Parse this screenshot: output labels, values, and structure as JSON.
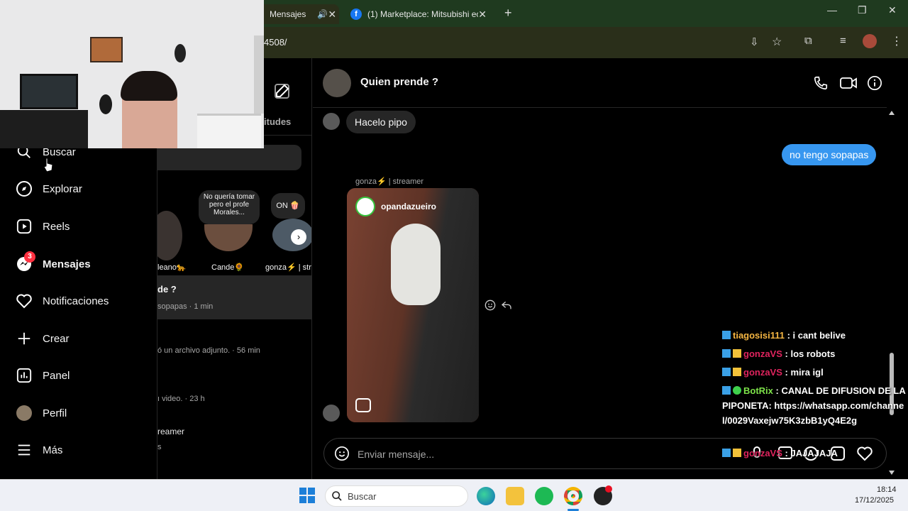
{
  "browser": {
    "tabs": [
      {
        "label": "Mensajes",
        "active": true
      },
      {
        "label": "(1) Marketplace: Mitsubishi ecli",
        "active": false
      }
    ],
    "url_fragment": "4508/"
  },
  "nav": {
    "items": [
      {
        "label": "Buscar",
        "icon": "search-icon"
      },
      {
        "label": "Explorar",
        "icon": "compass-icon"
      },
      {
        "label": "Reels",
        "icon": "reels-icon"
      },
      {
        "label": "Mensajes",
        "icon": "messenger-icon",
        "badge": "3"
      },
      {
        "label": "Notificaciones",
        "icon": "heart-icon"
      },
      {
        "label": "Crear",
        "icon": "plus-icon"
      },
      {
        "label": "Panel",
        "icon": "chart-icon"
      },
      {
        "label": "Perfil",
        "icon": "avatar"
      },
      {
        "label": "Más",
        "icon": "menu-icon"
      }
    ]
  },
  "inbox": {
    "requests_label": "itudes",
    "notes": [
      {
        "note": "",
        "name": "leano🐆"
      },
      {
        "note": "No quería tomar pero el profe Morales...",
        "name": "Cande🌻"
      },
      {
        "note": "ON 🍿",
        "name": "gonza⚡ | str"
      }
    ],
    "threads": [
      {
        "title": "de ?",
        "preview": "sopapas · 1 min"
      },
      {
        "title": "",
        "preview": "ó un archivo adjunto. · 56 min"
      },
      {
        "title": "",
        "preview": "ı video. · 23 h"
      },
      {
        "title": "reamer",
        "preview": "s"
      }
    ]
  },
  "chat": {
    "title": "Quien prende ?",
    "messages": {
      "incoming_1": "Hacelo pipo",
      "outgoing_1": "no tengo sopapas",
      "reel_sender": "gonza⚡ | streamer",
      "reel_account": "opandazueiro"
    },
    "composer_placeholder": "Enviar mensaje..."
  },
  "stream_chat": [
    {
      "user": "tiagosisi111",
      "text": " : i cant belive",
      "color": "#f5b642"
    },
    {
      "user": "gonzaVS",
      "text": " : los robots",
      "color": "#e0245e"
    },
    {
      "user": "gonzaVS",
      "text": " : mira igl",
      "color": "#e0245e"
    },
    {
      "user": "BotRix",
      "text": " : CANAL DE DIFUSION DE LA PIPONETA: https://whatsapp.com/channel/0029Vaxejw75K3zbB1yQ4E2g",
      "color": "#7ee34a"
    },
    {
      "user": "gonzaVS",
      "text": " : JAJAJAJA",
      "color": "#e0245e"
    }
  ],
  "taskbar": {
    "search_label": "Buscar",
    "time": "18:14",
    "date": "17/12/2025"
  },
  "colors": {
    "accent_blue": "#3797f0",
    "badge_red": "#ff3040"
  }
}
